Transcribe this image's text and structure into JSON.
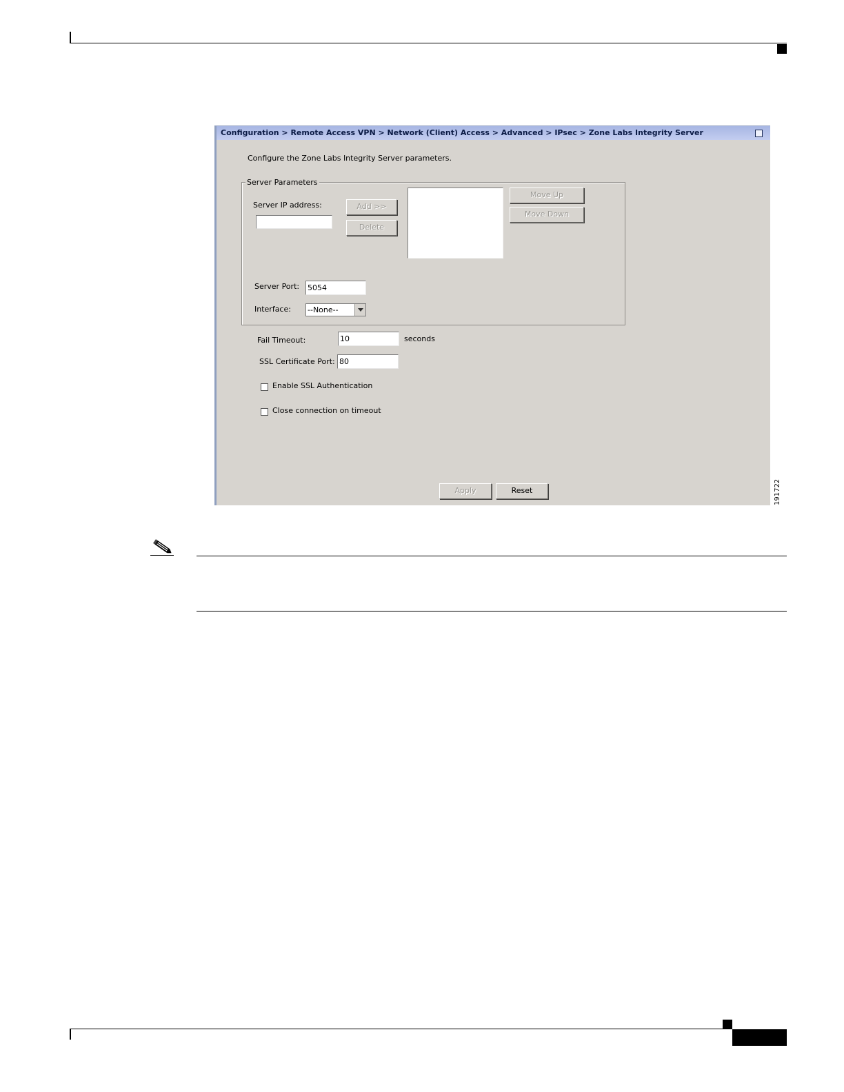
{
  "titlebar": {
    "breadcrumb": "Configuration > Remote Access VPN > Network (Client) Access > Advanced > IPsec > Zone Labs Integrity Server"
  },
  "intro_text": "Configure the Zone Labs Integrity Server parameters.",
  "server_parameters": {
    "legend": "Server Parameters",
    "server_ip_label": "Server IP address:",
    "server_ip_value": "",
    "add_label": "Add >>",
    "delete_label": "Delete",
    "move_up_label": "Move Up",
    "move_down_label": "Move Down",
    "server_port_label": "Server Port:",
    "server_port_value": "5054",
    "interface_label": "Interface:",
    "interface_value": "--None--"
  },
  "fail_timeout": {
    "label": "Fail Timeout:",
    "value": "10",
    "unit": "seconds"
  },
  "ssl_cert_port": {
    "label": "SSL Certificate Port:",
    "value": "80"
  },
  "checkboxes": {
    "enable_ssl_auth": {
      "label": "Enable SSL Authentication",
      "checked": false
    },
    "close_on_timeout": {
      "label": "Close connection on timeout",
      "checked": false
    }
  },
  "footer_buttons": {
    "apply": "Apply",
    "reset": "Reset"
  },
  "figure_id": "191722",
  "icons": {
    "note": "pencil-icon",
    "maximize": "maximize-icon",
    "dropdown": "chevron-down-icon"
  },
  "colors": {
    "titlebar": "#b6c2ea",
    "panel_bg": "#d7d4cf"
  }
}
